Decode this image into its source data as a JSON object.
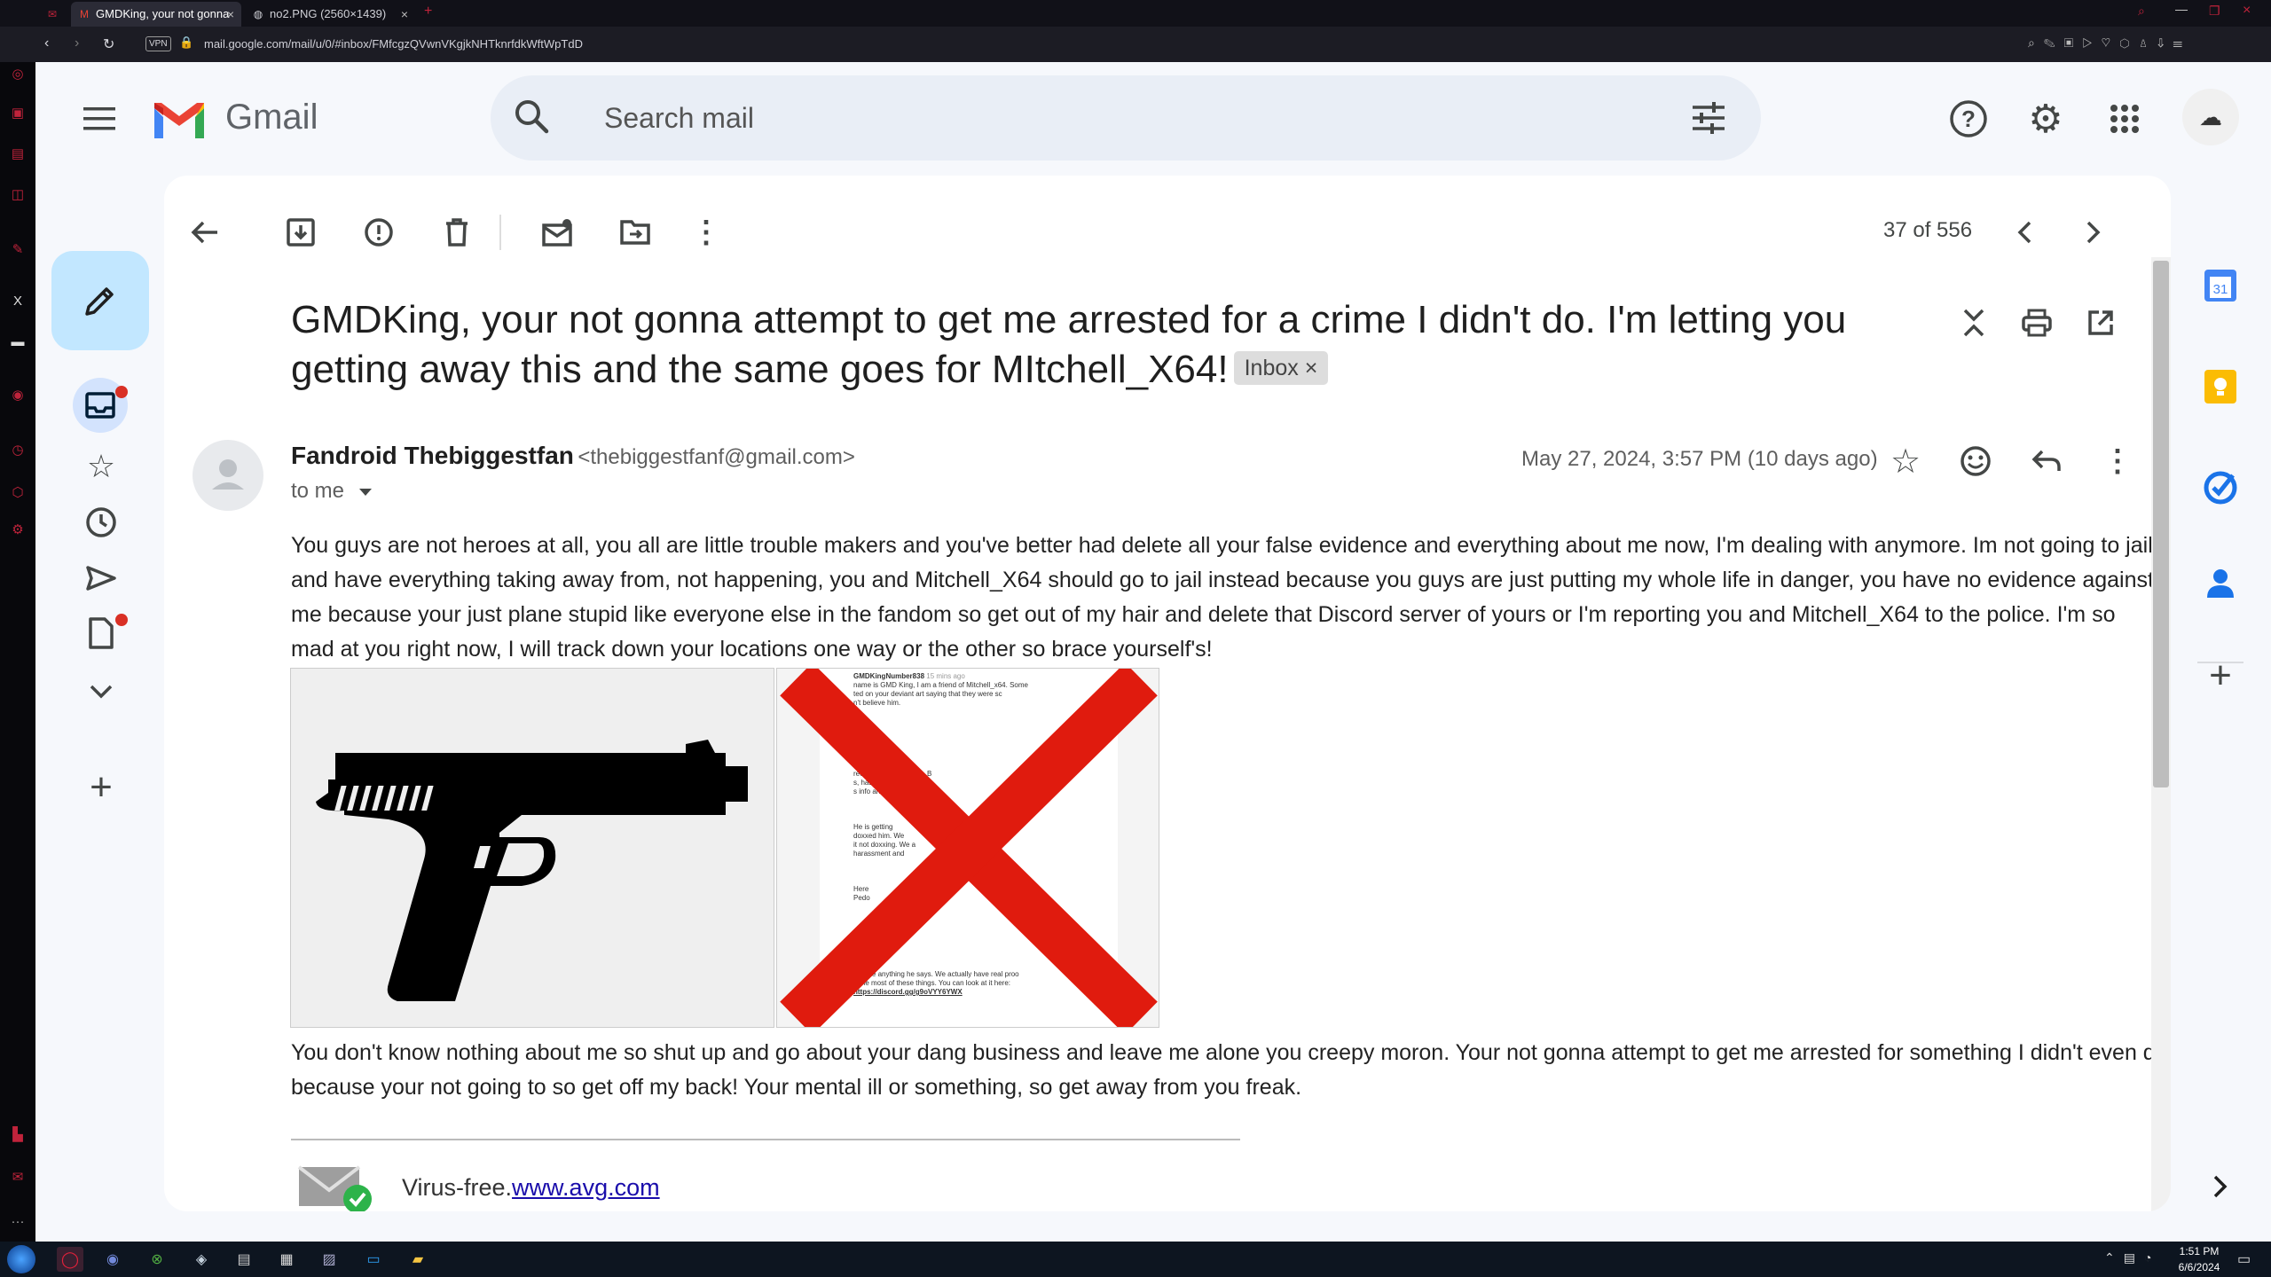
{
  "browser": {
    "tabs": [
      {
        "title": "GMDKing, your not gonna",
        "active": true
      },
      {
        "title": "no2.PNG (2560×1439)",
        "active": false
      }
    ],
    "add_tab": "+",
    "vpn_badge": "VPN",
    "url": "mail.google.com/mail/u/0/#inbox/FMfcgzQVwnVKgjkNHTknrfdkWftWpTdD"
  },
  "gmail": {
    "logo_text": "Gmail",
    "search_placeholder": "Search mail",
    "pagination": "37 of 556",
    "subject": "GMDKing, your not gonna attempt to get me arrested for a crime I didn't do. I'm letting you getting away this and the same goes for MItchell_X64!",
    "label_chip": "Inbox",
    "label_chip_close": "×",
    "sender_name": "Fandroid Thebiggestfan",
    "sender_email": "<thebiggestfanf@gmail.com>",
    "recipient": "to me",
    "date": "May 27, 2024, 3:57 PM (10 days ago)",
    "body_paragraph_1": "You guys are not heroes at all, you all are little trouble makers and you've better had delete all your false evidence and everything about me now, I'm dealing with anymore. Im not going to jail and have everything taking away from, not happening, you and Mitchell_X64 should go to jail instead because you guys are just putting my whole life in danger, you have no evidence against me because your just plane stupid like everyone else in the fandom so get out of my hair and delete that Discord server of yours or I'm reporting you and Mitchell_X64 to the police. I'm so mad at you right now, I will track down your locations one way or the other so brace yourself's!",
    "body_paragraph_2": "You don't know nothing about me so shut up and go about your dang business and leave me alone you creepy moron. Your not gonna attempt to get me arrested for something I didn't even do because your not going to so get off my back! Your mental ill or something, so get away from you freak.",
    "signature_prefix": "Virus-free.",
    "signature_link": "www.avg.com",
    "calendar_badge": "31",
    "attachment_2_lines": {
      "username": "GMDKingNumber838",
      "time": "15 mins ago",
      "line1": "name is GMD King, I am a friend of Mitchell_x64. Some",
      "line2": "ted on your deviant art saying that they were sc",
      "line3": "n't believe him.",
      "line4": "ree25, FandroidBuddy, B",
      "line5": "s, has been haras",
      "line6": "s info and a",
      "line7": "He is getting",
      "line8": "doxxed him. We",
      "line9": "it not doxxing. We a",
      "line10": "harassment and",
      "line11": "Here",
      "line12": "Pedo",
      "line13": "ssion of CP (7)",
      "line14": "believe anything he says. We actually have real proo",
      "line15": "done most of these things. You can look at it here:",
      "line16": "https://discord.gg/g9oVYY6YWX"
    }
  },
  "taskbar": {
    "time": "1:51 PM",
    "date": "6/6/2024"
  },
  "colors": {
    "gmail_bg": "#f6f8fc",
    "compose_bg": "#c2e7ff",
    "red_x": "#e01b0e",
    "link": "#1a0dab"
  }
}
